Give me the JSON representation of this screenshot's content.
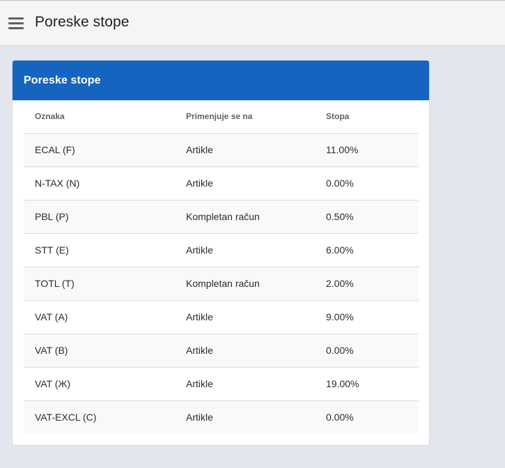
{
  "header": {
    "title": "Poreske stope"
  },
  "card": {
    "title": "Poreske stope"
  },
  "table": {
    "columns": [
      "Oznaka",
      "Primenjuje se na",
      "Stopa"
    ],
    "rows": [
      [
        "ECAL (F)",
        "Artikle",
        "11.00%"
      ],
      [
        "N-TAX (N)",
        "Artikle",
        "0.00%"
      ],
      [
        "PBL (P)",
        "Kompletan račun",
        "0.50%"
      ],
      [
        "STT (E)",
        "Artikle",
        "6.00%"
      ],
      [
        "TOTL (T)",
        "Kompletan račun",
        "2.00%"
      ],
      [
        "VAT (A)",
        "Artikle",
        "9.00%"
      ],
      [
        "VAT (B)",
        "Artikle",
        "0.00%"
      ],
      [
        "VAT (Ж)",
        "Artikle",
        "19.00%"
      ],
      [
        "VAT-EXCL (C)",
        "Artikle",
        "0.00%"
      ]
    ]
  },
  "colors": {
    "card_header": "#1565c0",
    "background": "#e3e6ee",
    "appbar": "#f5f5f5"
  }
}
